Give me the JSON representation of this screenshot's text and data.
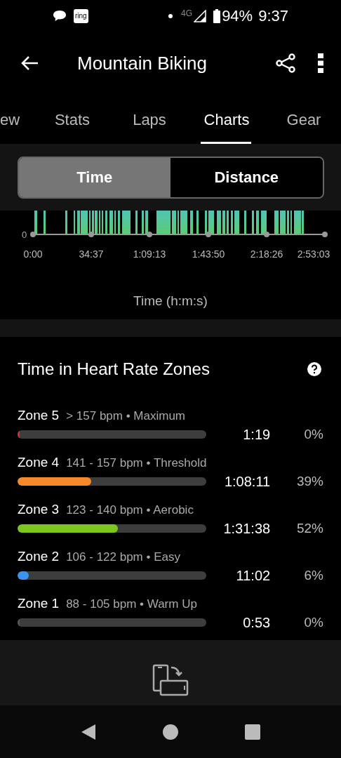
{
  "status_bar": {
    "app_badge": "ring",
    "network": "4G",
    "battery": "94%",
    "time": "9:37"
  },
  "app_bar": {
    "title": "Mountain Biking"
  },
  "tabs": [
    {
      "label": "ew",
      "selected": false
    },
    {
      "label": "Stats",
      "selected": false
    },
    {
      "label": "Laps",
      "selected": false
    },
    {
      "label": "Charts",
      "selected": true
    },
    {
      "label": "Gear",
      "selected": false
    }
  ],
  "segments": [
    {
      "label": "Time",
      "selected": true
    },
    {
      "label": "Distance",
      "selected": false
    }
  ],
  "chart": {
    "y_label": "0",
    "x_labels": [
      "0:00",
      "34:37",
      "1:09:13",
      "1:43:50",
      "2:18:26",
      "2:53:03"
    ],
    "axis_title": "Time (h:m:s)"
  },
  "zones_card": {
    "title": "Time in Heart Rate Zones",
    "zones": [
      {
        "name": "Zone 5",
        "detail": "> 157 bpm • Maximum",
        "level": 0.01,
        "color": "#d0312d",
        "time": "1:19",
        "percent": "0%"
      },
      {
        "name": "Zone 4",
        "detail": "141 - 157 bpm • Threshold",
        "level": 0.39,
        "color": "#f7892a",
        "time": "1:08:11",
        "percent": "39%"
      },
      {
        "name": "Zone 3",
        "detail": "123 - 140 bpm • Aerobic",
        "level": 0.53,
        "color": "#7dc61f",
        "time": "1:31:38",
        "percent": "52%"
      },
      {
        "name": "Zone 2",
        "detail": "106 - 122 bpm • Easy",
        "level": 0.06,
        "color": "#3b95f0",
        "time": "11:02",
        "percent": "6%"
      },
      {
        "name": "Zone 1",
        "detail": "88 - 105 bpm • Warm Up",
        "level": 0.005,
        "color": "#555555",
        "time": "0:53",
        "percent": "0%"
      }
    ]
  }
}
